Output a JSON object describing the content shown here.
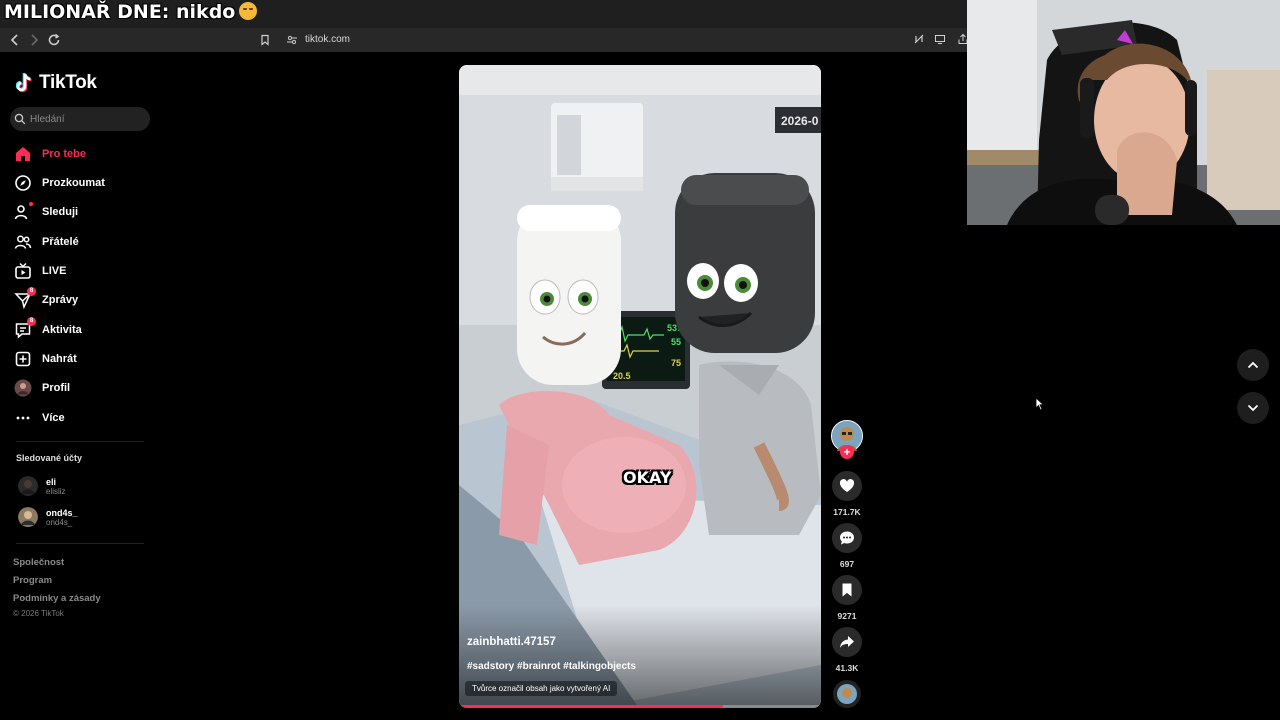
{
  "overlay": {
    "title": "MILIONAŘ DNE: nikdo",
    "emoji": "pensive-face"
  },
  "browser": {
    "url": "tiktok.com"
  },
  "app": {
    "name": "TikTok"
  },
  "search": {
    "placeholder": "Hledání"
  },
  "nav": {
    "items": [
      {
        "label": "Pro tebe",
        "icon": "home-icon",
        "active": true
      },
      {
        "label": "Prozkoumat",
        "icon": "compass-icon"
      },
      {
        "label": "Sleduji",
        "icon": "following-icon"
      },
      {
        "label": "Přátelé",
        "icon": "friends-icon"
      },
      {
        "label": "LIVE",
        "icon": "live-icon"
      },
      {
        "label": "Zprávy",
        "icon": "messages-icon",
        "badge": "8"
      },
      {
        "label": "Aktivita",
        "icon": "activity-icon",
        "badge": "8"
      },
      {
        "label": "Nahrát",
        "icon": "upload-icon"
      },
      {
        "label": "Profil",
        "icon": "profile-icon"
      },
      {
        "label": "Více",
        "icon": "more-icon"
      }
    ]
  },
  "following": {
    "title": "Sledované účty",
    "accounts": [
      {
        "name": "eli",
        "handle": "elisliz"
      },
      {
        "name": "ond4s_",
        "handle": "ond4s_"
      }
    ]
  },
  "footer": {
    "links": [
      "Společnost",
      "Program",
      "Podmínky a zásady"
    ],
    "copyright": "© 2026 TikTok"
  },
  "video": {
    "author": "zainbhatti.47157",
    "tags": "#sadstory #brainrot #talkingobjects",
    "ai_label": "Tvůrce označil obsah jako vytvořený AI",
    "caption_word": "OKAY",
    "progress": 0.73,
    "scene_date": "2026-0",
    "monitor_values": [
      "537",
      "55",
      "75",
      "20.5"
    ]
  },
  "actions": {
    "likes": "171.7K",
    "comments": "697",
    "saves": "9271",
    "shares": "41.3K"
  },
  "colors": {
    "accent": "#fe2c55",
    "background": "#000000",
    "sidebar_text": "#ffffff"
  }
}
